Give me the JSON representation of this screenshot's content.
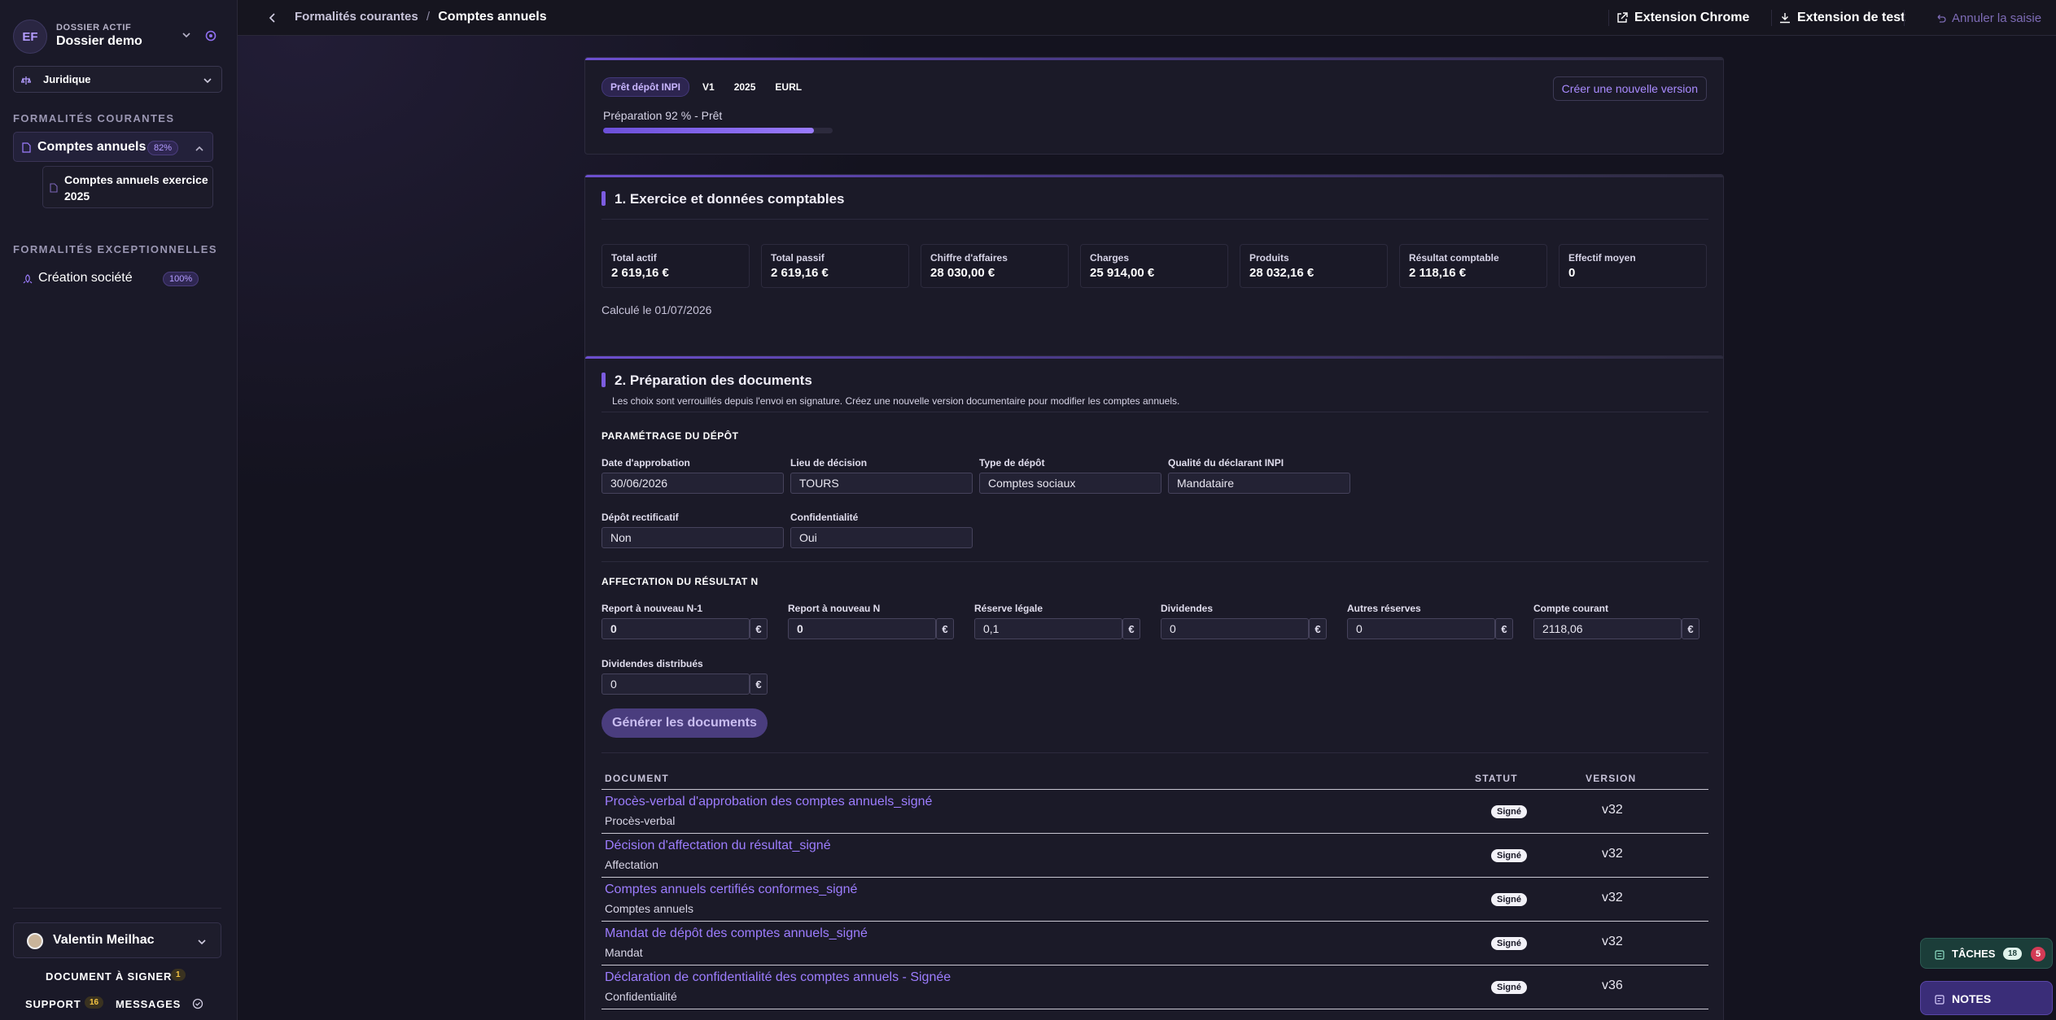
{
  "sidebar": {
    "avatar_initials": "EF",
    "dossier_label": "DOSSIER ACTIF",
    "dossier_name": "Dossier demo",
    "category_select": "Juridique",
    "section_courantes": "FORMALITÉS COURANTES",
    "item_comptes": {
      "label": "Comptes annuels",
      "badge": "82%"
    },
    "subitem_exercice": "Comptes annuels exercice 2025",
    "section_exceptionnelles": "FORMALITÉS EXCEPTIONNELLES",
    "item_creation": {
      "label": "Création société",
      "badge": "100%"
    },
    "user_name": "Valentin Meilhac",
    "doc_sign_label": "DOCUMENT À SIGNER",
    "doc_sign_count": "1",
    "support_label": "SUPPORT",
    "support_count": "16",
    "messages_label": "MESSAGES"
  },
  "topbar": {
    "breadcrumb_parent": "Formalités courantes",
    "breadcrumb_sep": "/",
    "breadcrumb_current": "Comptes annuels",
    "ext_chrome": "Extension Chrome",
    "ext_test": "Extension de test",
    "undo": "Annuler la saisie"
  },
  "status_card": {
    "chips": [
      "Prêt dépôt INPI",
      "V1",
      "2025",
      "EURL"
    ],
    "progress_text": "Préparation 92 % - Prêt",
    "progress_value": 0.92,
    "new_version_button": "Créer une nouvelle version"
  },
  "section1": {
    "title": "1. Exercice et données comptables",
    "stats": [
      {
        "label": "Total actif",
        "value": "2 619,16 €"
      },
      {
        "label": "Total passif",
        "value": "2 619,16 €"
      },
      {
        "label": "Chiffre d'affaires",
        "value": "28 030,00 €"
      },
      {
        "label": "Charges",
        "value": "25 914,00 €"
      },
      {
        "label": "Produits",
        "value": "28 032,16 €"
      },
      {
        "label": "Résultat comptable",
        "value": "2 118,16 €"
      },
      {
        "label": "Effectif moyen",
        "value": "0"
      }
    ],
    "calculated": "Calculé le 01/07/2026"
  },
  "section2": {
    "title": "2. Préparation des documents",
    "notice": "Les choix sont verrouillés depuis l'envoi en signature. Créez une nouvelle version documentaire pour modifier les comptes annuels.",
    "param_heading": "PARAMÉTRAGE DU DÉPÔT",
    "date_label": "Date d'approbation",
    "date_value": "30/06/2026",
    "lieu_label": "Lieu de décision",
    "lieu_value": "TOURS",
    "type_label": "Type de dépôt",
    "type_value": "Comptes sociaux",
    "qualite_label": "Qualité du déclarant INPI",
    "qualite_value": "Mandataire",
    "rectif_label": "Dépôt rectificatif",
    "rectif_value": "Non",
    "confid_label": "Confidentialité",
    "confid_value": "Oui",
    "affect_heading": "AFFECTATION DU RÉSULTAT N",
    "report_n1_label": "Report à nouveau N-1",
    "report_n1_value": "0",
    "report_n_label": "Report à nouveau N",
    "report_n_value": "0",
    "reserve_legale_label": "Réserve légale",
    "reserve_legale_value": "0,1",
    "dividendes_label": "Dividendes",
    "dividendes_value": "0",
    "autres_label": "Autres réserves",
    "autres_value": "0",
    "compte_label": "Compte courant",
    "compte_value": "2118,06",
    "div_distrib_label": "Dividendes distribués",
    "div_distrib_value": "0",
    "currency": "€",
    "generate_button": "Générer les documents"
  },
  "documents": {
    "headers": {
      "document": "DOCUMENT",
      "statut": "STATUT",
      "version": "VERSION"
    },
    "rows": [
      {
        "title": "Procès-verbal d'approbation des comptes annuels_signé",
        "type": "Procès-verbal",
        "status": "Signé",
        "version": "v32"
      },
      {
        "title": "Décision d'affectation du résultat_signé",
        "type": "Affectation",
        "status": "Signé",
        "version": "v32"
      },
      {
        "title": "Comptes annuels certifiés conformes_signé",
        "type": "Comptes annuels",
        "status": "Signé",
        "version": "v32"
      },
      {
        "title": "Mandat de dépôt des comptes annuels_signé",
        "type": "Mandat",
        "status": "Signé",
        "version": "v32"
      },
      {
        "title": "Déclaration de confidentialité des comptes annuels - Signée",
        "type": "Confidentialité",
        "status": "Signé",
        "version": "v36"
      }
    ]
  },
  "floating": {
    "tasks_label": "TÂCHES",
    "tasks_count": "18",
    "tasks_alert": "5",
    "notes_label": "NOTES"
  },
  "colors": {
    "accent": "#7c5ce0",
    "link": "#9d7dff",
    "background": "#14131f"
  }
}
